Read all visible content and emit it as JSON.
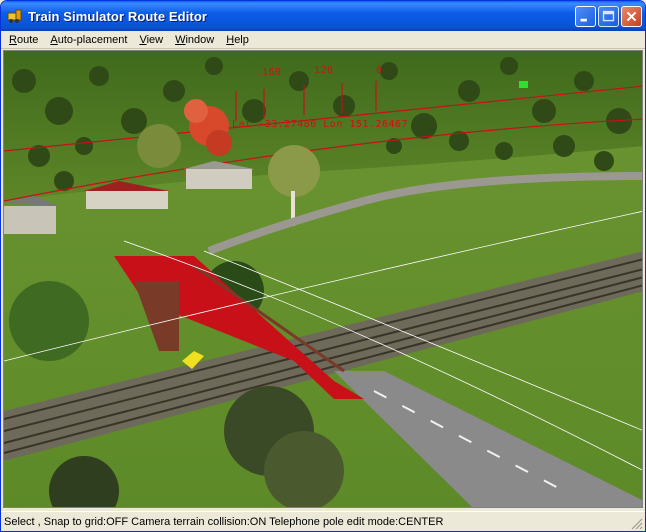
{
  "window": {
    "title": "Train Simulator Route Editor",
    "icon": "train-app-icon"
  },
  "title_buttons": {
    "minimize": "minimize-icon",
    "maximize": "maximize-icon",
    "close": "close-icon"
  },
  "menu": {
    "items": [
      {
        "label": "Route"
      },
      {
        "label": "Auto-placement"
      },
      {
        "label": "View"
      },
      {
        "label": "Window"
      },
      {
        "label": "Help"
      }
    ]
  },
  "viewport": {
    "overlay": {
      "marker_1": "160",
      "marker_2": "120",
      "marker_3": "0",
      "coords": "Lat -33.27480  Lon 151.26467"
    },
    "colors": {
      "selection_red": "#c81018",
      "overlay_red": "#d21010",
      "grass": "#6a8e30",
      "road": "#8a8a8a"
    }
  },
  "status": {
    "text": "Select , Snap to grid:OFF Camera terrain collision:ON Telephone pole edit mode:CENTER"
  }
}
